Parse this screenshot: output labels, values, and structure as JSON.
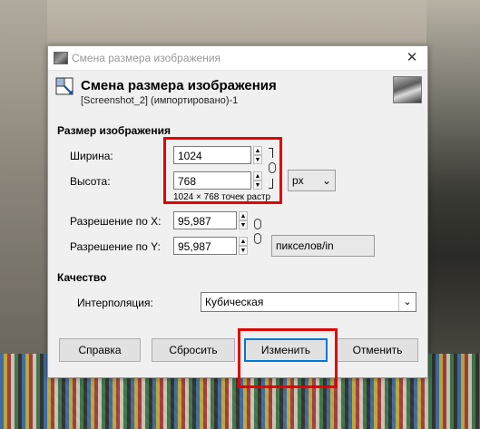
{
  "window": {
    "title": "Смена размера изображения",
    "close_symbol": "✕"
  },
  "header": {
    "title": "Смена размера изображения",
    "subtitle": "[Screenshot_2] (импортировано)-1"
  },
  "image_size": {
    "section_title": "Размер изображения",
    "width_label": "Ширина:",
    "width_value": "1024",
    "height_label": "Высота:",
    "height_value": "768",
    "size_info": "1024 × 768 точек растр",
    "unit": "px",
    "res_x_label": "Разрешение по X:",
    "res_x_value": "95,987",
    "res_y_label": "Разрешение по Y:",
    "res_y_value": "95,987",
    "res_unit": "пикселов/in"
  },
  "quality": {
    "section_title": "Качество",
    "interp_label": "Интерполяция:",
    "interp_value": "Кубическая"
  },
  "buttons": {
    "help": "Справка",
    "reset": "Сбросить",
    "change": "Изменить",
    "cancel": "Отменить"
  },
  "icons": {
    "title_icon": "gimp-app-icon",
    "header_icon": "resize-icon",
    "chain_icon": "chain-link-icon"
  },
  "colors": {
    "highlight": "#e00000",
    "default_button_border": "#0078d7"
  }
}
